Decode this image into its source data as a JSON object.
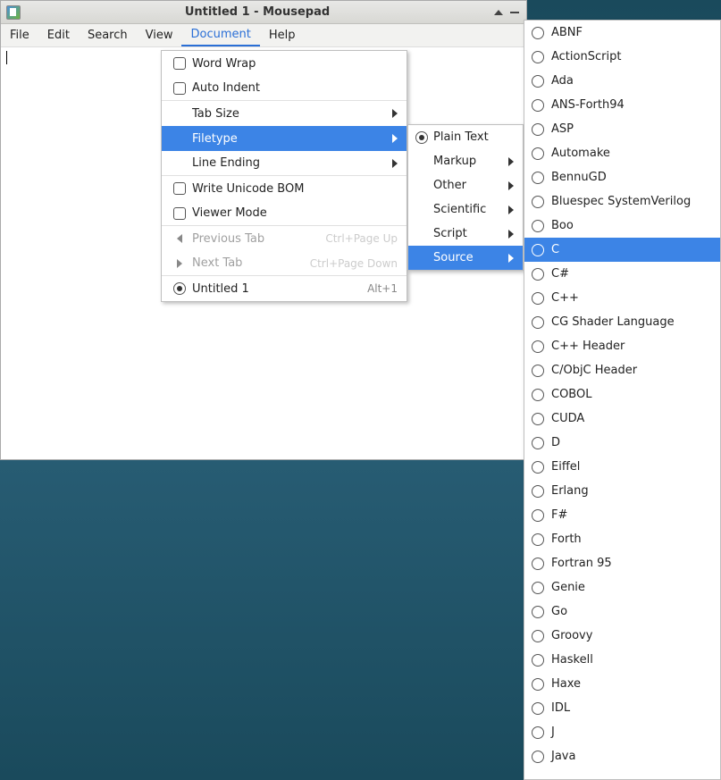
{
  "window": {
    "title": "Untitled 1 - Mousepad"
  },
  "menubar": {
    "items": [
      "File",
      "Edit",
      "Search",
      "View",
      "Document",
      "Help"
    ],
    "active_index": 4
  },
  "document_menu": {
    "word_wrap": "Word Wrap",
    "auto_indent": "Auto Indent",
    "tab_size": "Tab Size",
    "filetype": "Filetype",
    "line_ending": "Line Ending",
    "write_bom": "Write Unicode BOM",
    "viewer_mode": "Viewer Mode",
    "prev_tab": "Previous Tab",
    "prev_tab_accel": "Ctrl+Page Up",
    "next_tab": "Next Tab",
    "next_tab_accel": "Ctrl+Page Down",
    "doc1": "Untitled 1",
    "doc1_accel": "Alt+1"
  },
  "filetype_menu": {
    "plain_text": "Plain Text",
    "markup": "Markup",
    "other": "Other",
    "scientific": "Scientific",
    "script": "Script",
    "source": "Source"
  },
  "source_menu": {
    "items": [
      "ABNF",
      "ActionScript",
      "Ada",
      "ANS-Forth94",
      "ASP",
      "Automake",
      "BennuGD",
      "Bluespec SystemVerilog",
      "Boo",
      "C",
      "C#",
      "C++",
      "CG Shader Language",
      "C++ Header",
      "C/ObjC Header",
      "COBOL",
      "CUDA",
      "D",
      "Eiffel",
      "Erlang",
      "F#",
      "Forth",
      "Fortran 95",
      "Genie",
      "Go",
      "Groovy",
      "Haskell",
      "Haxe",
      "IDL",
      "J",
      "Java"
    ],
    "highlight_index": 9
  }
}
